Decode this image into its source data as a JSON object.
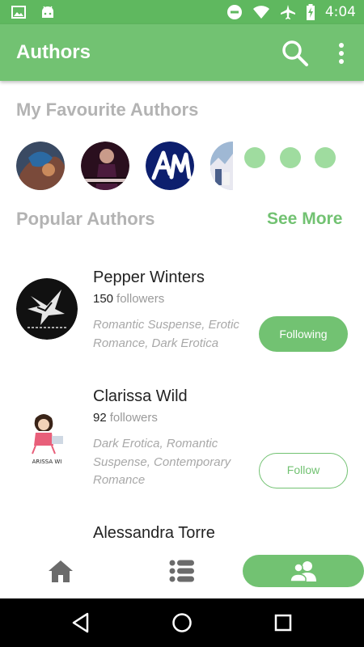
{
  "status_bar": {
    "time": "4:04",
    "icons": [
      "image-icon",
      "android-icon",
      "do-not-disturb-icon",
      "wifi-icon",
      "airplane-icon",
      "battery-charging-icon"
    ]
  },
  "app_bar": {
    "title": "Authors",
    "icons": [
      "search-icon",
      "more-vert-icon"
    ]
  },
  "favourites": {
    "title": "My Favourite Authors",
    "avatars": [
      "favourite-author-1",
      "favourite-author-2",
      "favourite-author-3",
      "favourite-author-4"
    ],
    "pager_dots": 3
  },
  "popular": {
    "title": "Popular Authors",
    "see_more": "See More",
    "authors": [
      {
        "name": "Pepper Winters",
        "followers_count": "150",
        "followers_label": "followers",
        "genres": "Romantic Suspense, Erotic Romance, Dark Erotica",
        "button": "Following"
      },
      {
        "name": "Clarissa Wild",
        "followers_count": "92",
        "followers_label": "followers",
        "genres": "Dark Erotica, Romantic Suspense, Contemporary Romance",
        "button": "Follow"
      },
      {
        "name": "Alessandra Torre"
      }
    ]
  },
  "bottom_tabs": [
    {
      "icon": "home-icon",
      "active": false
    },
    {
      "icon": "list-icon",
      "active": false
    },
    {
      "icon": "people-icon",
      "active": true
    }
  ],
  "colors": {
    "primary": "#72c272",
    "status_bar": "#5fb85f",
    "section_title": "#b3b3b3",
    "pager_dot": "#9fdc9f"
  }
}
